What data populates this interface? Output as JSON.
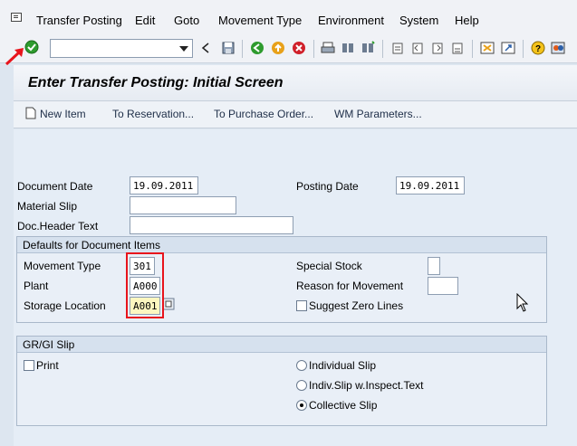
{
  "menu": {
    "items": [
      "Transfer Posting",
      "Edit",
      "Goto",
      "Movement Type",
      "Environment",
      "System",
      "Help"
    ]
  },
  "toolbar": {
    "command_field": "",
    "icons": [
      "enter-icon",
      "back-icon",
      "save-icon",
      "back-green-icon",
      "exit-icon",
      "cancel-icon",
      "print-icon",
      "find-icon",
      "find-next-icon",
      "first-page-icon",
      "prev-page-icon",
      "next-page-icon",
      "last-page-icon",
      "create-session-icon",
      "shortcut-icon",
      "help-icon",
      "customize-layout-icon"
    ]
  },
  "screen": {
    "title": "Enter Transfer Posting: Initial Screen"
  },
  "app_toolbar": {
    "new_item": "New Item",
    "to_reservation": "To Reservation...",
    "to_purchase_order": "To Purchase Order...",
    "wm_parameters": "WM Parameters..."
  },
  "header": {
    "document_date_label": "Document Date",
    "document_date": "19.09.2011",
    "posting_date_label": "Posting Date",
    "posting_date": "19.09.2011",
    "material_slip_label": "Material Slip",
    "material_slip": "",
    "doc_header_text_label": "Doc.Header Text",
    "doc_header_text": ""
  },
  "defaults": {
    "title": "Defaults for Document Items",
    "movement_type_label": "Movement Type",
    "movement_type": "301",
    "plant_label": "Plant",
    "plant": "A000",
    "storage_location_label": "Storage Location",
    "storage_location": "A001",
    "special_stock_label": "Special Stock",
    "special_stock": "",
    "reason_label": "Reason for Movement",
    "reason": "",
    "suggest_zero_lines_label": "Suggest Zero Lines",
    "suggest_zero_lines_checked": false
  },
  "grgi": {
    "title": "GR/GI Slip",
    "print_label": "Print",
    "print_checked": false,
    "individual_slip": "Individual Slip",
    "indiv_slip_inspect": "Indiv.Slip w.Inspect.Text",
    "collective_slip": "Collective Slip",
    "selected": "Collective Slip"
  },
  "colors": {
    "highlight_border": "#e8141c",
    "field_highlight": "#fdf7c0",
    "enter_check": "#2e9b2e"
  }
}
